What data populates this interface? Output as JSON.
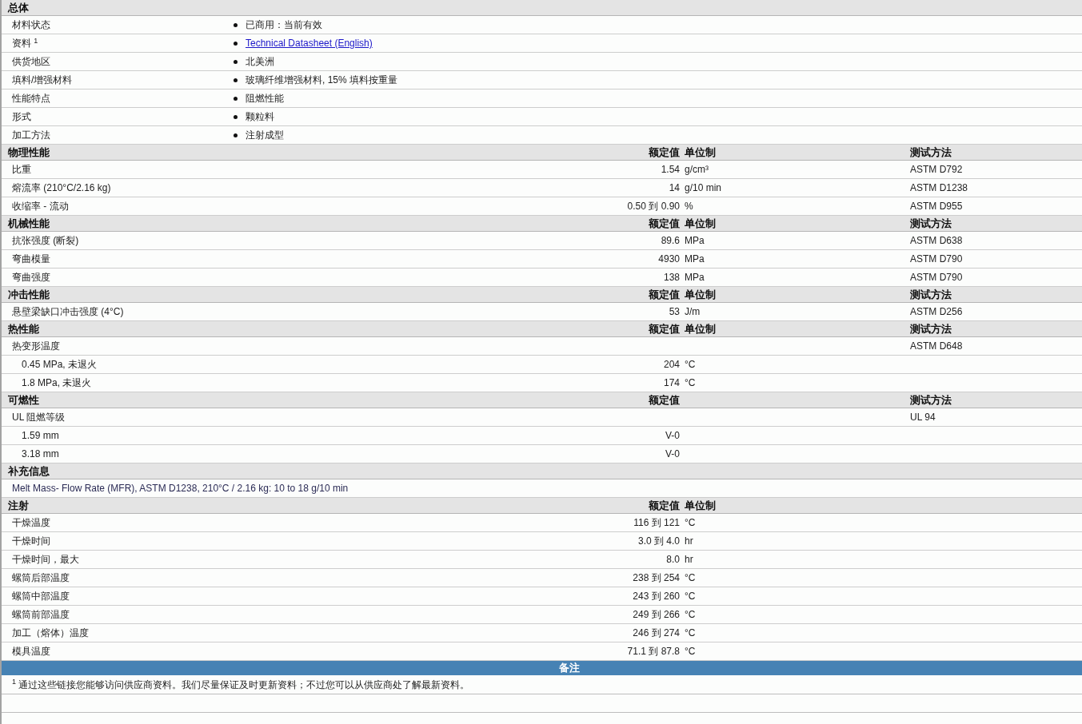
{
  "general": {
    "title": "总体",
    "rows": [
      {
        "label": "材料状态",
        "value": "已商用：当前有效",
        "kind": "text"
      },
      {
        "label": "资料 $^{1}$",
        "value": "Technical Datasheet (English)",
        "kind": "link"
      },
      {
        "label": "供货地区",
        "value": "北美洲",
        "kind": "text"
      },
      {
        "label": "填料/增强材料",
        "value": "玻璃纤维增强材料, 15% 填料按重量",
        "kind": "text"
      },
      {
        "label": "性能特点",
        "value": "阻燃性能",
        "kind": "text"
      },
      {
        "label": "形式",
        "value": "颗粒料",
        "kind": "text"
      },
      {
        "label": "加工方法",
        "value": "注射成型",
        "kind": "text"
      }
    ]
  },
  "sections": [
    {
      "kind": "properties",
      "title": "物理性能",
      "value_heading": "额定值",
      "unit_heading": "单位制",
      "method_heading": "测试方法",
      "rows": [
        {
          "label": "比重",
          "value": "1.54",
          "unit": "g/cm³",
          "method": "ASTM D792"
        },
        {
          "label": "熔流率 (210°C/2.16 kg)",
          "value": "14",
          "unit": "g/10 min",
          "method": "ASTM D1238"
        },
        {
          "label": "收缩率 - 流动",
          "value": "0.50 到 0.90",
          "unit": "%",
          "method": "ASTM D955"
        }
      ]
    },
    {
      "kind": "properties",
      "title": "机械性能",
      "value_heading": "额定值",
      "unit_heading": "单位制",
      "method_heading": "测试方法",
      "rows": [
        {
          "label": "抗张强度 (断裂)",
          "value": "89.6",
          "unit": "MPa",
          "method": "ASTM D638"
        },
        {
          "label": "弯曲模量",
          "value": "4930",
          "unit": "MPa",
          "method": "ASTM D790"
        },
        {
          "label": "弯曲强度",
          "value": "138",
          "unit": "MPa",
          "method": "ASTM D790"
        }
      ]
    },
    {
      "kind": "properties",
      "title": "冲击性能",
      "value_heading": "额定值",
      "unit_heading": "单位制",
      "method_heading": "测试方法",
      "rows": [
        {
          "label": "悬壁梁缺口冲击强度 (4°C)",
          "value": "53",
          "unit": "J/m",
          "method": "ASTM D256"
        }
      ]
    },
    {
      "kind": "properties",
      "title": "热性能",
      "value_heading": "额定值",
      "unit_heading": "单位制",
      "method_heading": "测试方法",
      "rows": [
        {
          "label": "热变形温度",
          "method": "ASTM D648",
          "children": [
            {
              "label": "0.45 MPa, 未退火",
              "value": "204",
              "unit": "°C"
            },
            {
              "label": "1.8 MPa, 未退火",
              "value": "174",
              "unit": "°C"
            }
          ]
        }
      ]
    },
    {
      "kind": "properties",
      "title": "可燃性",
      "value_heading": "额定值",
      "method_heading": "测试方法",
      "rows": [
        {
          "label": "UL 阻燃等级",
          "method": "UL 94",
          "children": [
            {
              "label": "1.59 mm",
              "value": "V-0"
            },
            {
              "label": "3.18 mm",
              "value": "V-0"
            }
          ]
        }
      ]
    },
    {
      "kind": "notes",
      "title": "补充信息",
      "lines": [
        "Melt Mass- Flow Rate (MFR), ASTM D1238, 210°C / 2.16 kg: 10 to 18 g/10 min"
      ]
    },
    {
      "kind": "properties",
      "title": "注射",
      "value_heading": "额定值",
      "unit_heading": "单位制",
      "rows": [
        {
          "label": "干燥温度",
          "value": "116 到 121",
          "unit": "°C"
        },
        {
          "label": "干燥时间",
          "value": "3.0 到 4.0",
          "unit": "hr"
        },
        {
          "label": "干燥时间，最大",
          "value": "8.0",
          "unit": "hr"
        },
        {
          "label": "螺筒后部温度",
          "value": "238 到 254",
          "unit": "°C"
        },
        {
          "label": "螺筒中部温度",
          "value": "243 到 260",
          "unit": "°C"
        },
        {
          "label": "螺筒前部温度",
          "value": "249 到 266",
          "unit": "°C"
        },
        {
          "label": "加工（熔体）温度",
          "value": "246 到 274",
          "unit": "°C"
        },
        {
          "label": "模具温度",
          "value": "71.1 到 87.8",
          "unit": "°C"
        }
      ]
    }
  ],
  "remarks": {
    "title": "备注",
    "footnotes": [
      "$^{1}$ 通过这些链接您能够访问供应商资料。我们尽量保证及时更新资料；不过您可以从供应商处了解最新资料。"
    ]
  }
}
